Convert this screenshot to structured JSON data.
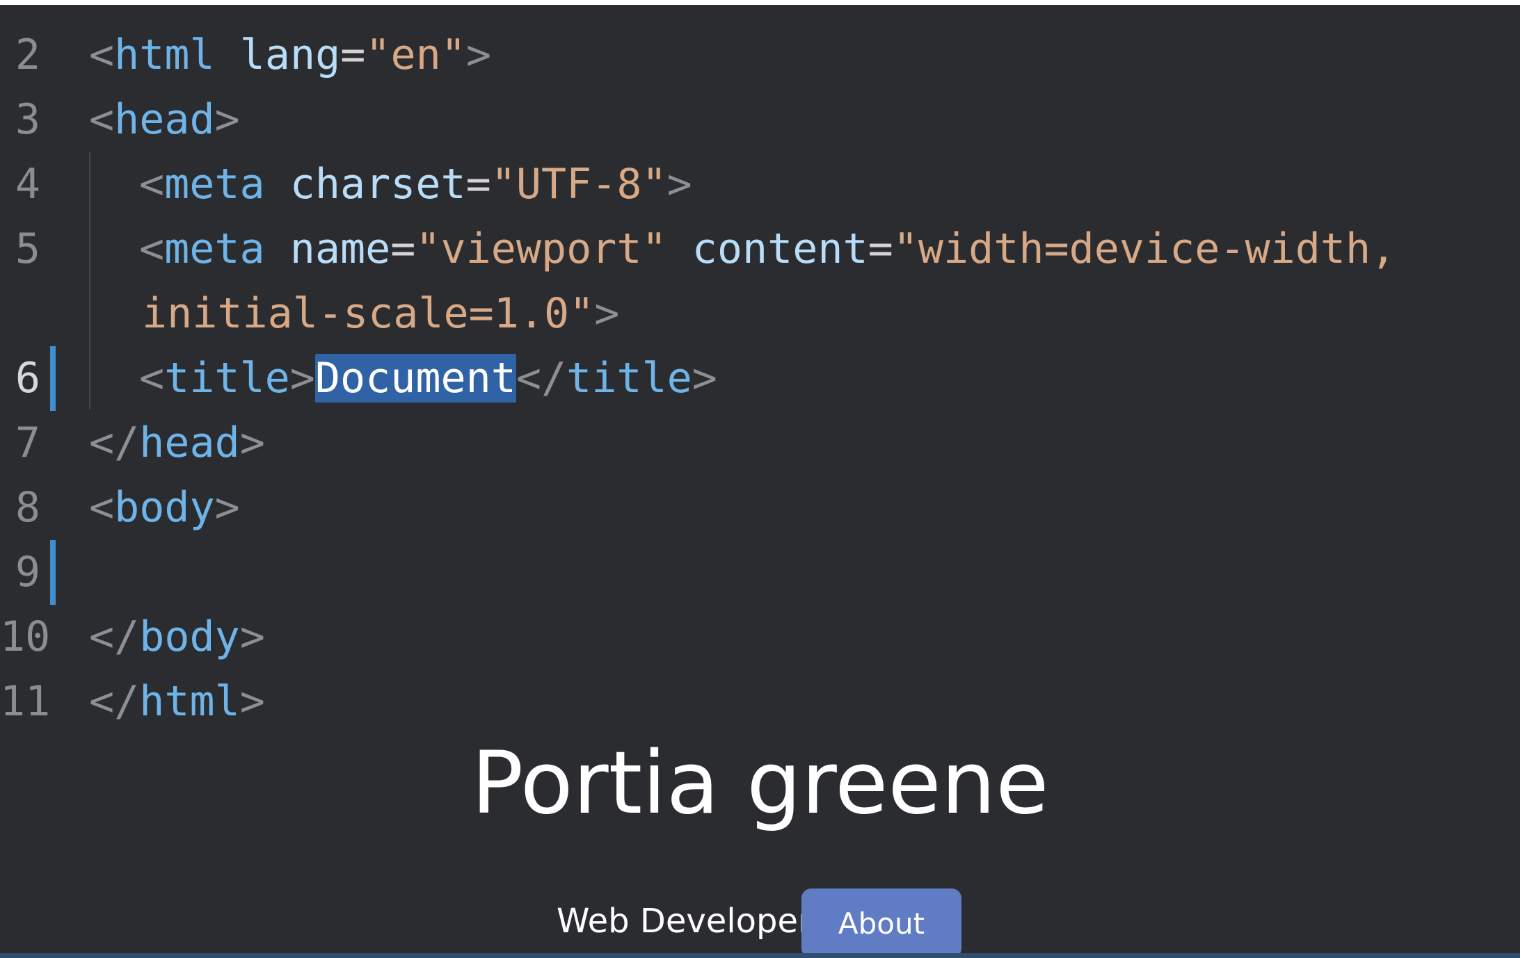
{
  "editor": {
    "line_numbers": [
      "2",
      "3",
      "4",
      "5",
      "6",
      "7",
      "8",
      "9",
      "10",
      "11"
    ],
    "lines": [
      {
        "tokens": [
          {
            "t": "<",
            "k": "bracket"
          },
          {
            "t": "html",
            "k": "tag"
          },
          {
            "t": " ",
            "k": "text"
          },
          {
            "t": "lang",
            "k": "attr"
          },
          {
            "t": "=",
            "k": "eq"
          },
          {
            "t": "\"en\"",
            "k": "str"
          },
          {
            "t": ">",
            "k": "bracket"
          }
        ]
      },
      {
        "tokens": [
          {
            "t": "<",
            "k": "bracket"
          },
          {
            "t": "head",
            "k": "tag"
          },
          {
            "t": ">",
            "k": "bracket"
          }
        ]
      },
      {
        "tokens": [
          {
            "t": "<",
            "k": "bracket"
          },
          {
            "t": "meta",
            "k": "tag"
          },
          {
            "t": " ",
            "k": "text"
          },
          {
            "t": "charset",
            "k": "attr"
          },
          {
            "t": "=",
            "k": "eq"
          },
          {
            "t": "\"UTF-8\"",
            "k": "str"
          },
          {
            "t": ">",
            "k": "bracket"
          }
        ]
      },
      {
        "tokens": [
          {
            "t": "<",
            "k": "bracket"
          },
          {
            "t": "meta",
            "k": "tag"
          },
          {
            "t": " ",
            "k": "text"
          },
          {
            "t": "name",
            "k": "attr"
          },
          {
            "t": "=",
            "k": "eq"
          },
          {
            "t": "\"viewport\"",
            "k": "str"
          },
          {
            "t": " ",
            "k": "text"
          },
          {
            "t": "content",
            "k": "attr"
          },
          {
            "t": "=",
            "k": "eq"
          },
          {
            "t": "\"width=device-width,",
            "k": "str"
          }
        ]
      },
      {
        "tokens": [
          {
            "t": "initial-scale=1.0\"",
            "k": "str"
          },
          {
            "t": ">",
            "k": "bracket"
          }
        ]
      },
      {
        "tokens": [
          {
            "t": "<",
            "k": "bracket"
          },
          {
            "t": "title",
            "k": "tag"
          },
          {
            "t": ">",
            "k": "bracket"
          },
          {
            "t": "Document",
            "k": "text",
            "selected": true
          },
          {
            "t": "</",
            "k": "bracket"
          },
          {
            "t": "title",
            "k": "tag"
          },
          {
            "t": ">",
            "k": "bracket"
          }
        ]
      },
      {
        "tokens": [
          {
            "t": "</",
            "k": "bracket"
          },
          {
            "t": "head",
            "k": "tag"
          },
          {
            "t": ">",
            "k": "bracket"
          }
        ]
      },
      {
        "tokens": [
          {
            "t": "<",
            "k": "bracket"
          },
          {
            "t": "body",
            "k": "tag"
          },
          {
            "t": ">",
            "k": "bracket"
          }
        ]
      },
      {
        "tokens": []
      },
      {
        "tokens": [
          {
            "t": "</",
            "k": "bracket"
          },
          {
            "t": "body",
            "k": "tag"
          },
          {
            "t": ">",
            "k": "bracket"
          }
        ]
      },
      {
        "tokens": [
          {
            "t": "</",
            "k": "bracket"
          },
          {
            "t": "html",
            "k": "tag"
          },
          {
            "t": ">",
            "k": "bracket"
          }
        ]
      }
    ],
    "selection_color": "#2f63a6",
    "change_marker_color": "#3f8fd0"
  },
  "preview": {
    "title": "Portia greene",
    "subtitle": "Web Developer",
    "about_label": "About",
    "button_color": "#5f7cc5"
  }
}
